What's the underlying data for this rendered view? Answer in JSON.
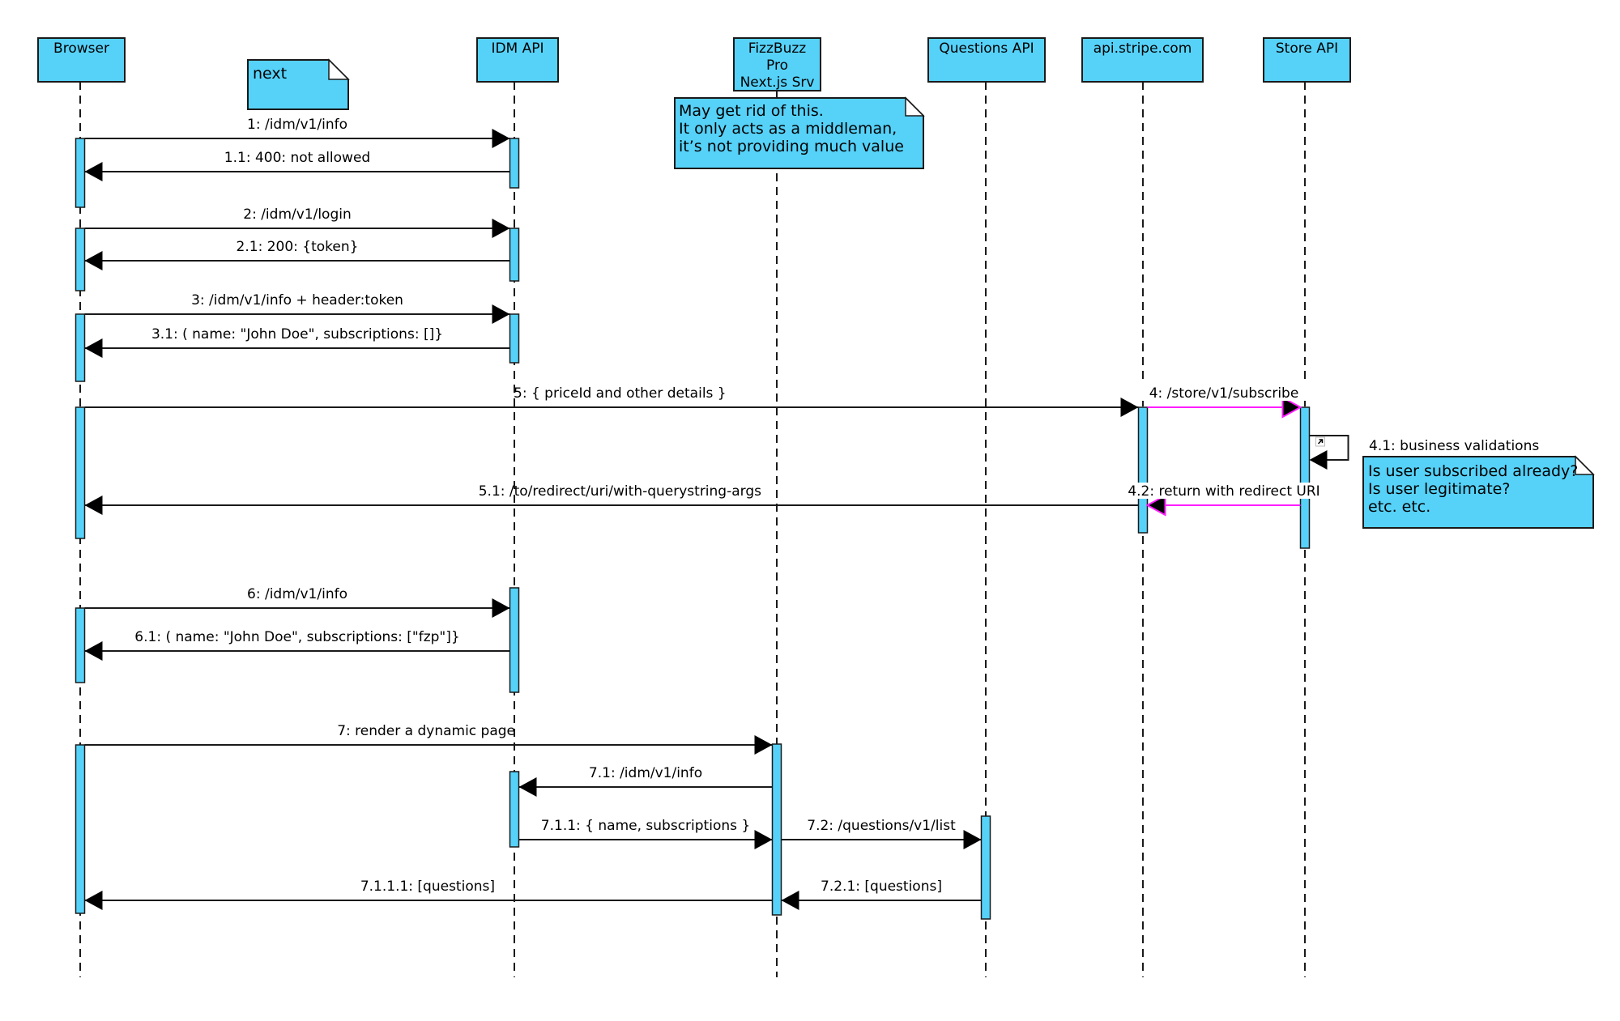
{
  "diagram": {
    "type": "uml-sequence-diagram",
    "colors": {
      "fill": "#56d2f9",
      "stroke": "#1a1a1a",
      "highlight_message": "#ff1dff"
    },
    "participants": [
      {
        "id": "browser",
        "lines": [
          "Browser"
        ]
      },
      {
        "id": "idm",
        "lines": [
          "IDM API"
        ]
      },
      {
        "id": "fizzbuzz",
        "lines": [
          "FizzBuzz",
          "Pro",
          "Next.js Srv"
        ]
      },
      {
        "id": "questions",
        "lines": [
          "Questions API"
        ]
      },
      {
        "id": "stripe",
        "lines": [
          "api.stripe.com"
        ]
      },
      {
        "id": "store",
        "lines": [
          "Store API"
        ]
      }
    ],
    "notes": [
      {
        "id": "note-next",
        "lines": [
          "next"
        ]
      },
      {
        "id": "note-middleman",
        "attached_to": "fizzbuzz",
        "lines": [
          "May get rid of this.",
          "It only acts as a middleman,",
          "it’s not providing much value"
        ]
      },
      {
        "id": "note-validations",
        "attached_to": "store",
        "lines": [
          "Is user subscribed already?",
          "Is user legitimate?",
          "etc. etc."
        ]
      }
    ],
    "messages": [
      {
        "id": "m1",
        "label": "1: /idm/v1/info",
        "from": "browser",
        "to": "idm",
        "style": "normal"
      },
      {
        "id": "m1-1",
        "label": "1.1: 400: not allowed",
        "from": "idm",
        "to": "browser",
        "style": "normal"
      },
      {
        "id": "m2",
        "label": "2: /idm/v1/login",
        "from": "browser",
        "to": "idm",
        "style": "normal"
      },
      {
        "id": "m2-1",
        "label": "2.1: 200: {token}",
        "from": "idm",
        "to": "browser",
        "style": "normal"
      },
      {
        "id": "m3",
        "label": "3: /idm/v1/info + header:token",
        "from": "browser",
        "to": "idm",
        "style": "normal"
      },
      {
        "id": "m3-1",
        "label": "3.1: ( name: \"John Doe\", subscriptions: []}",
        "from": "idm",
        "to": "browser",
        "style": "normal"
      },
      {
        "id": "m5",
        "label": "5: { priceId and other details }",
        "from": "browser",
        "to": "stripe",
        "style": "normal"
      },
      {
        "id": "m4",
        "label": "4: /store/v1/subscribe",
        "from": "stripe",
        "to": "store",
        "style": "magenta"
      },
      {
        "id": "m4-1",
        "label": "4.1:  business validations",
        "from": "store",
        "to": "store",
        "style": "self"
      },
      {
        "id": "m4-2",
        "label": "4.2: return with redirect URI",
        "from": "store",
        "to": "stripe",
        "style": "magenta"
      },
      {
        "id": "m5-1",
        "label": "5.1: /to/redirect/uri/with-querystring-args",
        "from": "stripe",
        "to": "browser",
        "style": "normal"
      },
      {
        "id": "m6",
        "label": "6: /idm/v1/info",
        "from": "browser",
        "to": "idm",
        "style": "normal"
      },
      {
        "id": "m6-1",
        "label": "6.1: ( name: \"John Doe\", subscriptions: [\"fzp\"]}",
        "from": "idm",
        "to": "browser",
        "style": "normal"
      },
      {
        "id": "m7",
        "label": "7: render a dynamic page",
        "from": "browser",
        "to": "fizzbuzz",
        "style": "normal"
      },
      {
        "id": "m7-1",
        "label": "7.1: /idm/v1/info",
        "from": "fizzbuzz",
        "to": "idm",
        "style": "normal"
      },
      {
        "id": "m7-1-1",
        "label": "7.1.1: { name, subscriptions }",
        "from": "idm",
        "to": "fizzbuzz",
        "style": "normal"
      },
      {
        "id": "m7-2",
        "label": "7.2: /questions/v1/list",
        "from": "fizzbuzz",
        "to": "questions",
        "style": "normal"
      },
      {
        "id": "m7-2-1",
        "label": "7.2.1: [questions]",
        "from": "questions",
        "to": "fizzbuzz",
        "style": "normal"
      },
      {
        "id": "m7-1-1-1",
        "label": "7.1.1.1: [questions]",
        "from": "fizzbuzz",
        "to": "browser",
        "style": "normal"
      }
    ]
  }
}
